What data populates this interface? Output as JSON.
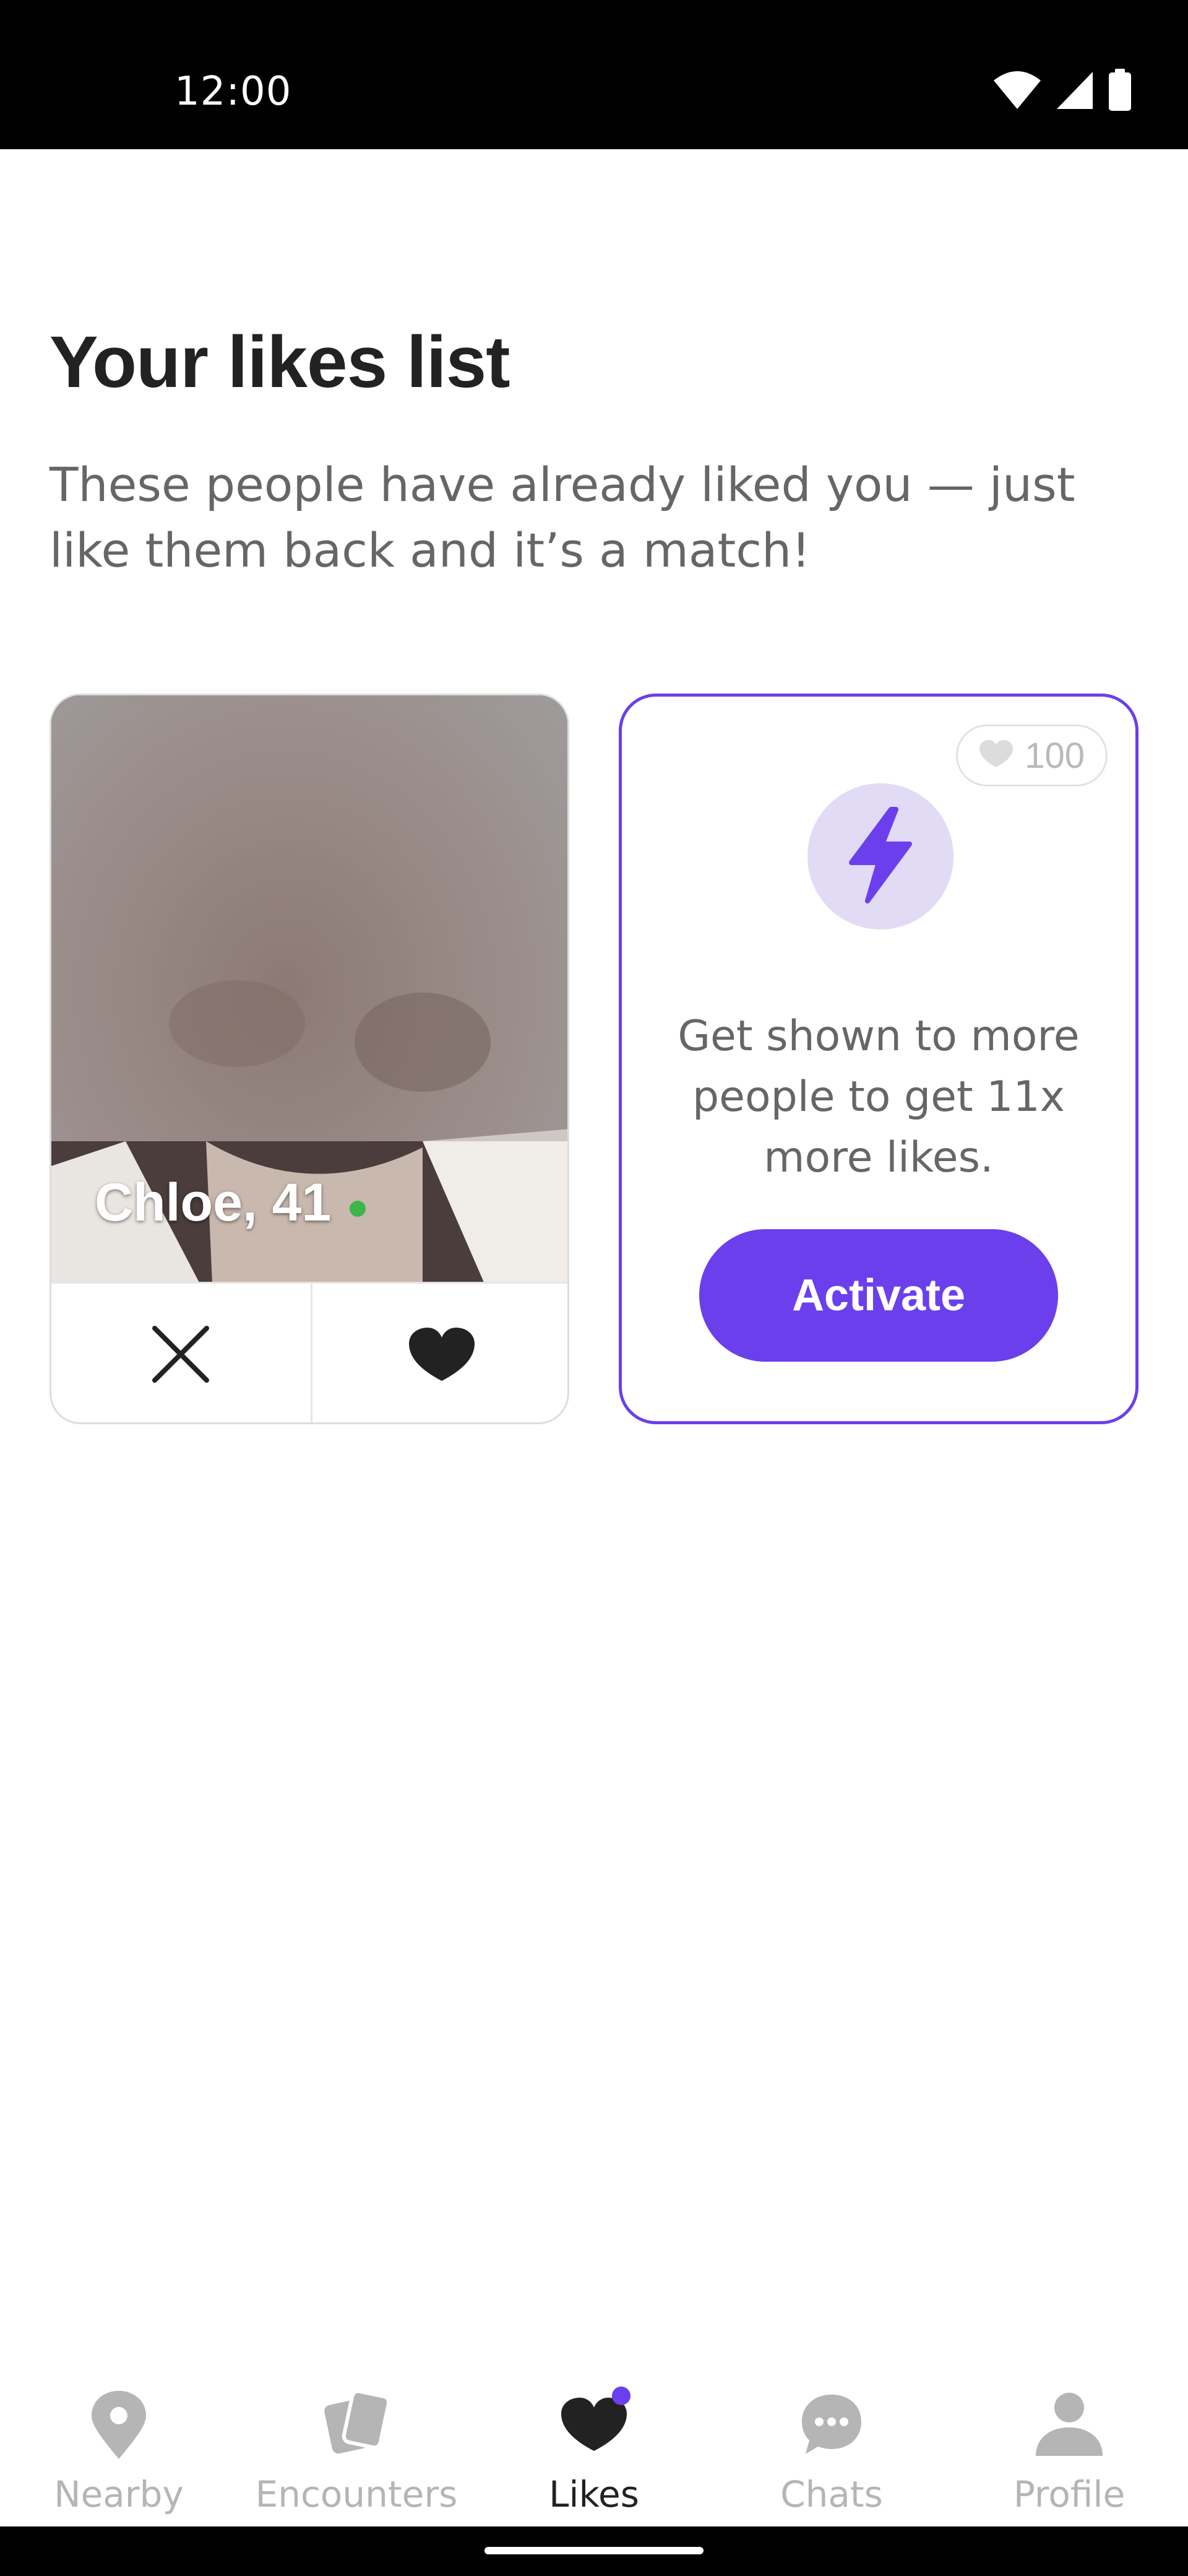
{
  "status_bar": {
    "time": "12:00",
    "icons": [
      "wifi-icon",
      "signal-icon",
      "battery-icon"
    ]
  },
  "header": {
    "title": "Your likes list",
    "subtitle": "These people have already liked you — just like them back and it’s a match!"
  },
  "profile_card": {
    "name_age": "Chloe, 41",
    "online": true,
    "actions": {
      "dislike_icon": "close-icon",
      "like_icon": "heart-icon"
    }
  },
  "boost_card": {
    "credits": "100",
    "icon": "lightning-icon",
    "text": "Get shown to more people to get 11x more likes.",
    "button_label": "Activate"
  },
  "bottom_nav": {
    "items": [
      {
        "label": "Nearby",
        "icon": "location-pin-icon",
        "active": false
      },
      {
        "label": "Encounters",
        "icon": "cards-icon",
        "active": false
      },
      {
        "label": "Likes",
        "icon": "heart-icon",
        "active": true,
        "badge": true
      },
      {
        "label": "Chats",
        "icon": "chat-bubble-icon",
        "active": false
      },
      {
        "label": "Profile",
        "icon": "person-icon",
        "active": false
      }
    ]
  },
  "colors": {
    "accent": "#6b3fec",
    "accent_light": "#e1dbf6",
    "text_primary": "#222222",
    "text_secondary": "#666666",
    "online": "#3cb54a",
    "nav_inactive": "#b5b5b5"
  }
}
